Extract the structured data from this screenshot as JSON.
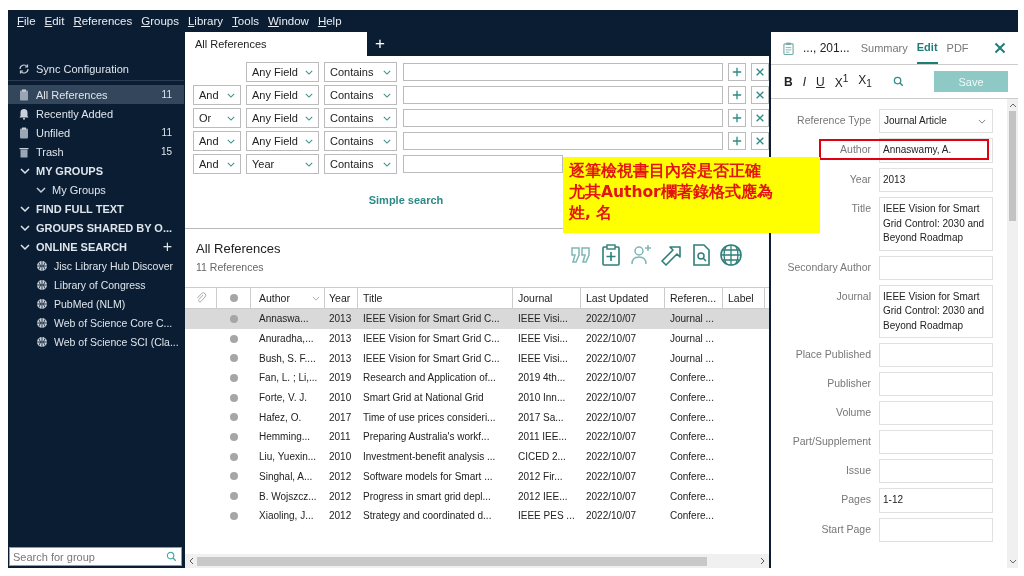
{
  "menu": [
    "File",
    "Edit",
    "References",
    "Groups",
    "Library",
    "Tools",
    "Window",
    "Help"
  ],
  "tabs": [
    {
      "label": "All References",
      "selected": true
    }
  ],
  "new_tab": "+",
  "sidebar": {
    "sync": "Sync Configuration",
    "items": [
      {
        "label": "All References",
        "count": "11",
        "selected": true
      },
      {
        "label": "Recently Added",
        "selected": false
      },
      {
        "label": "Unfiled",
        "count": "11",
        "selected": false
      },
      {
        "label": "Trash",
        "count": "15",
        "selected": false
      }
    ],
    "sections": [
      {
        "label": "MY GROUPS",
        "expanded": true,
        "children": [
          {
            "label": "My Groups",
            "expanded": true
          }
        ]
      },
      {
        "label": "FIND FULL TEXT",
        "expanded": true
      },
      {
        "label": "GROUPS SHARED BY O...",
        "expanded": true
      },
      {
        "label": "ONLINE SEARCH",
        "expanded": true,
        "add": "+",
        "children": [
          {
            "label": "Jisc Library Hub Discover"
          },
          {
            "label": "Library of Congress"
          },
          {
            "label": "PubMed (NLM)"
          },
          {
            "label": "Web of Science Core C..."
          },
          {
            "label": "Web of Science SCI (Cla..."
          }
        ]
      }
    ],
    "search_placeholder": "Search for group"
  },
  "search_rows": [
    {
      "field": "Any Field",
      "op": "Contains"
    },
    {
      "bool": "And",
      "field": "Any Field",
      "op": "Contains"
    },
    {
      "bool": "Or",
      "field": "Any Field",
      "op": "Contains"
    },
    {
      "bool": "And",
      "field": "Any Field",
      "op": "Contains"
    },
    {
      "bool": "And",
      "field": "Year",
      "op": "Contains"
    }
  ],
  "simple_search": "Simple search",
  "library": {
    "title": "All References",
    "count": "11 References"
  },
  "table": {
    "columns": [
      "Author",
      "Year",
      "Title",
      "Journal",
      "Last Updated",
      "Referen...",
      "Label"
    ],
    "rows": [
      {
        "selected": true,
        "cells": [
          "Annaswa...",
          "2013",
          "IEEE Vision for Smart Grid C...",
          "IEEE Visi...",
          "2022/10/07",
          "Journal ..."
        ]
      },
      {
        "selected": false,
        "cells": [
          "Anuradha,...",
          "2013",
          "IEEE Vision for Smart Grid C...",
          "IEEE Visi...",
          "2022/10/07",
          "Journal ..."
        ]
      },
      {
        "selected": false,
        "cells": [
          "Bush, S. F....",
          "2013",
          "IEEE Vision for Smart Grid C...",
          "IEEE Visi...",
          "2022/10/07",
          "Journal ..."
        ]
      },
      {
        "selected": false,
        "cells": [
          "Fan, L. ; Li,...",
          "2019",
          "Research and Application of...",
          "2019 4th...",
          "2022/10/07",
          "Confere..."
        ]
      },
      {
        "selected": false,
        "cells": [
          "Forte, V. J.",
          "2010",
          "Smart Grid at National Grid",
          "2010 Inn...",
          "2022/10/07",
          "Confere..."
        ]
      },
      {
        "selected": false,
        "cells": [
          "Hafez, O.",
          "2017",
          "Time of use prices consideri...",
          "2017 Sa...",
          "2022/10/07",
          "Confere..."
        ]
      },
      {
        "selected": false,
        "cells": [
          "Hemming...",
          "2011",
          "Preparing Australia's workf...",
          "2011 IEE...",
          "2022/10/07",
          "Confere..."
        ]
      },
      {
        "selected": false,
        "cells": [
          "Liu, Yuexin...",
          "2010",
          "Investment-benefit analysis ...",
          "CICED 2...",
          "2022/10/07",
          "Confere..."
        ]
      },
      {
        "selected": false,
        "cells": [
          "Singhal, A...",
          "2012",
          "Software models for Smart ...",
          "2012 Fir...",
          "2022/10/07",
          "Confere..."
        ]
      },
      {
        "selected": false,
        "cells": [
          "B. Wojszcz...",
          "2012",
          "Progress in smart grid depl...",
          "2012 IEE...",
          "2022/10/07",
          "Confere..."
        ]
      },
      {
        "selected": false,
        "cells": [
          "Xiaoling, J...",
          "2012",
          "Strategy and coordinated d...",
          "IEEE PES ...",
          "2022/10/07",
          "Confere..."
        ]
      }
    ]
  },
  "panel": {
    "ref_title": "..., 201...",
    "tabs": [
      {
        "label": "Summary",
        "selected": false
      },
      {
        "label": "Edit",
        "selected": true
      },
      {
        "label": "PDF",
        "selected": false
      }
    ],
    "format": [
      "B",
      "I",
      "U",
      "X$^{1}$",
      "X$_{1}$"
    ],
    "save": "Save",
    "fields": [
      {
        "label": "Reference Type",
        "value": "Journal Article",
        "kind": "select"
      },
      {
        "label": "Author",
        "value": "Annaswamy, A.",
        "kind": "text",
        "highlighted": true
      },
      {
        "label": "Year",
        "value": "2013",
        "kind": "text"
      },
      {
        "label": "Title",
        "value": "IEEE Vision for Smart Grid Control: 2030 and Beyond Roadmap",
        "kind": "area"
      },
      {
        "label": "Secondary Author",
        "kind": "text"
      },
      {
        "label": "Journal",
        "value": "IEEE Vision for Smart Grid Control: 2030 and Beyond Roadmap",
        "kind": "area"
      },
      {
        "label": "Place Published",
        "kind": "text"
      },
      {
        "label": "Publisher",
        "kind": "text"
      },
      {
        "label": "Volume",
        "kind": "text"
      },
      {
        "label": "Part/Supplement",
        "kind": "text"
      },
      {
        "label": "Issue",
        "kind": "text"
      },
      {
        "label": "Pages",
        "value": "1-12",
        "kind": "text"
      },
      {
        "label": "Start Page",
        "kind": "text"
      }
    ]
  },
  "callout": {
    "lines": [
      "逐筆檢視書目內容是否正確",
      "尤其Author欄著錄格式應為",
      "姓, 名"
    ]
  }
}
